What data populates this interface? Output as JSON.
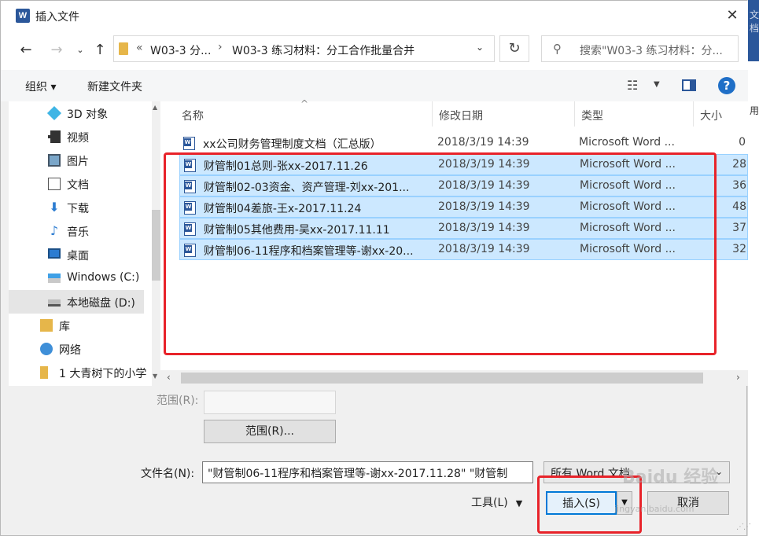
{
  "window": {
    "title": "插入文件"
  },
  "background": {
    "text1": "文档",
    "text2": "用"
  },
  "address": {
    "segment1": "W03-3 分...",
    "segment2": "W03-3 练习材料：分工合作批量合并",
    "search_placeholder": "搜索\"W03-3 练习材料：分..."
  },
  "toolbar": {
    "organize": "组织 ▾",
    "new_folder": "新建文件夹"
  },
  "nav_items": [
    {
      "label": "3D 对象",
      "icon": "cube-3d-icon"
    },
    {
      "label": "视频",
      "icon": "video-icon"
    },
    {
      "label": "图片",
      "icon": "picture-icon"
    },
    {
      "label": "文档",
      "icon": "document-icon"
    },
    {
      "label": "下载",
      "icon": "download-icon"
    },
    {
      "label": "音乐",
      "icon": "music-icon"
    },
    {
      "label": "桌面",
      "icon": "desktop-icon"
    },
    {
      "label": "Windows (C:)",
      "icon": "windows-drive-icon"
    },
    {
      "label": "本地磁盘 (D:)",
      "icon": "disk-drive-icon",
      "selected": true
    },
    {
      "label": "库",
      "icon": "library-icon"
    },
    {
      "label": "网络",
      "icon": "network-icon"
    },
    {
      "label": "1 大青树下的小学",
      "icon": "folder-icon"
    }
  ],
  "columns": {
    "name": "名称",
    "date": "修改日期",
    "type": "类型",
    "size": "大小"
  },
  "files": [
    {
      "name": "xx公司财务管理制度文档（汇总版）",
      "date": "2018/3/19 14:39",
      "type": "Microsoft Word ...",
      "size": "0",
      "selected": false
    },
    {
      "name": "财管制01总则-张xx-2017.11.26",
      "date": "2018/3/19 14:39",
      "type": "Microsoft Word ...",
      "size": "28",
      "selected": true
    },
    {
      "name": "财管制02-03资金、资产管理-刘xx-201...",
      "date": "2018/3/19 14:39",
      "type": "Microsoft Word ...",
      "size": "36",
      "selected": true
    },
    {
      "name": "财管制04差旅-王x-2017.11.24",
      "date": "2018/3/19 14:39",
      "type": "Microsoft Word ...",
      "size": "48",
      "selected": true
    },
    {
      "name": "财管制05其他费用-吴xx-2017.11.11",
      "date": "2018/3/19 14:39",
      "type": "Microsoft Word ...",
      "size": "37",
      "selected": true
    },
    {
      "name": "财管制06-11程序和档案管理等-谢xx-20...",
      "date": "2018/3/19 14:39",
      "type": "Microsoft Word ...",
      "size": "32",
      "selected": true
    }
  ],
  "form": {
    "range_label": "范围(R):",
    "range_button": "范围(R)...",
    "filename_label": "文件名(N):",
    "filename_value": "\"财管制06-11程序和档案管理等-谢xx-2017.11.28\" \"财管制",
    "filetype_value": "所有 Word 文档",
    "tools_label": "工具(L)",
    "insert_button": "插入(S)",
    "cancel_button": "取消"
  },
  "watermark": {
    "main": "Baidu 经验",
    "sub": "jingyan.baidu.com"
  },
  "colors": {
    "accent": "#0078d7",
    "selection": "#cce8ff",
    "highlight_box": "#e8232a",
    "word_blue": "#2b579a"
  }
}
